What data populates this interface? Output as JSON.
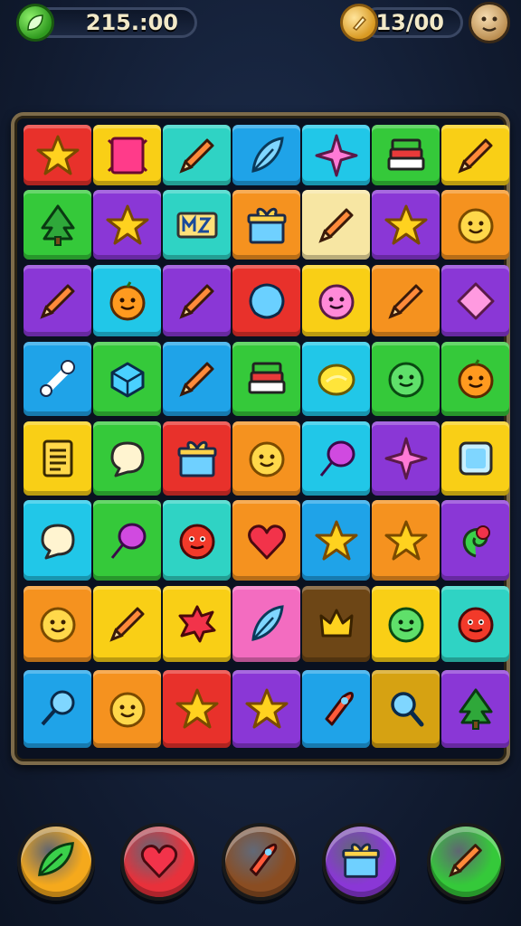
{
  "hud": {
    "score": "215.:00",
    "score_icon": "leaf-coin-icon",
    "coins": "13/00",
    "coins_icon": "gold-coin-icon",
    "avatar_icon": "player-avatar-icon"
  },
  "colors": {
    "red": "#e8312b",
    "yellow": "#f9cf16",
    "teal": "#2fd3c4",
    "blue": "#1fa3e8",
    "green": "#35c93a",
    "purple": "#8a37d6",
    "orange": "#f5921f",
    "pink": "#f36cc0",
    "cyan": "#21c7e8",
    "cream": "#f7e6a3",
    "brown": "#6d4616",
    "gold": "#d6a212"
  },
  "board": {
    "rows": [
      [
        [
          "red",
          "star-icon"
        ],
        [
          "yellow",
          "ribbon-icon"
        ],
        [
          "teal",
          "pencil-icon"
        ],
        [
          "blue",
          "feather-icon"
        ],
        [
          "cyan",
          "sparkle-star-icon"
        ],
        [
          "green",
          "books-icon"
        ],
        [
          "yellow",
          "pencil-icon"
        ]
      ],
      [
        [
          "green",
          "tree-icon"
        ],
        [
          "purple",
          "star-icon"
        ],
        [
          "teal",
          "text-block-icon"
        ],
        [
          "orange",
          "gift-box-icon"
        ],
        [
          "cream",
          "pencil-icon"
        ],
        [
          "purple",
          "star-icon"
        ],
        [
          "orange",
          "smiley-face-icon"
        ]
      ],
      [
        [
          "purple",
          "pencil-icon"
        ],
        [
          "cyan",
          "orange-face-icon"
        ],
        [
          "purple",
          "pencil-icon"
        ],
        [
          "red",
          "puzzle-blob-icon"
        ],
        [
          "yellow",
          "pink-face-icon"
        ],
        [
          "orange",
          "pencil-icon"
        ],
        [
          "purple",
          "diamond-icon"
        ]
      ],
      [
        [
          "blue",
          "bone-icon"
        ],
        [
          "green",
          "gem-cube-icon"
        ],
        [
          "blue",
          "pencil-icon"
        ],
        [
          "green",
          "books-icon"
        ],
        [
          "cyan",
          "lemon-icon"
        ],
        [
          "green",
          "green-face-icon"
        ],
        [
          "green",
          "orange-face-icon"
        ]
      ],
      [
        [
          "yellow",
          "notepad-icon"
        ],
        [
          "green",
          "speech-bubble-icon"
        ],
        [
          "red",
          "gift-box-icon"
        ],
        [
          "orange",
          "smiley-face-icon"
        ],
        [
          "cyan",
          "balloon-icon"
        ],
        [
          "purple",
          "sparkle-star-icon"
        ],
        [
          "yellow",
          "mirror-icon"
        ]
      ],
      [
        [
          "cyan",
          "speech-bubble-icon"
        ],
        [
          "green",
          "balloon-icon"
        ],
        [
          "teal",
          "red-face-icon"
        ],
        [
          "orange",
          "heart-icon"
        ],
        [
          "blue",
          "star-icon"
        ],
        [
          "orange",
          "star-icon"
        ],
        [
          "purple",
          "swirl-icon"
        ]
      ],
      [
        [
          "orange",
          "smiley-face-icon"
        ],
        [
          "yellow",
          "pencil-icon"
        ],
        [
          "yellow",
          "splat-icon"
        ],
        [
          "pink",
          "feather-icon"
        ],
        [
          "brown",
          "crown-icon"
        ],
        [
          "yellow",
          "green-face-icon"
        ],
        [
          "teal",
          "red-face-icon"
        ]
      ],
      [
        [
          "blue",
          "lollipop-icon"
        ],
        [
          "orange",
          "smiley-face-icon"
        ],
        [
          "red",
          "star-icon"
        ],
        [
          "purple",
          "star-icon"
        ],
        [
          "blue",
          "rocket-icon"
        ],
        [
          "gold",
          "magnifier-icon"
        ],
        [
          "purple",
          "tree-icon"
        ]
      ]
    ]
  },
  "boosters": [
    {
      "name": "leaf-booster-button",
      "icon": "leaf-icon",
      "color": "#f5a91c"
    },
    {
      "name": "heart-booster-button",
      "icon": "heart-icon",
      "color": "#e8313b"
    },
    {
      "name": "rocket-booster-button",
      "icon": "rocket-icon",
      "color": "#8a4d22"
    },
    {
      "name": "gift-booster-button",
      "icon": "gift-box-icon",
      "color": "#8a37d6"
    },
    {
      "name": "pencil-booster-button",
      "icon": "pencil-icon",
      "color": "#35c93a"
    }
  ]
}
